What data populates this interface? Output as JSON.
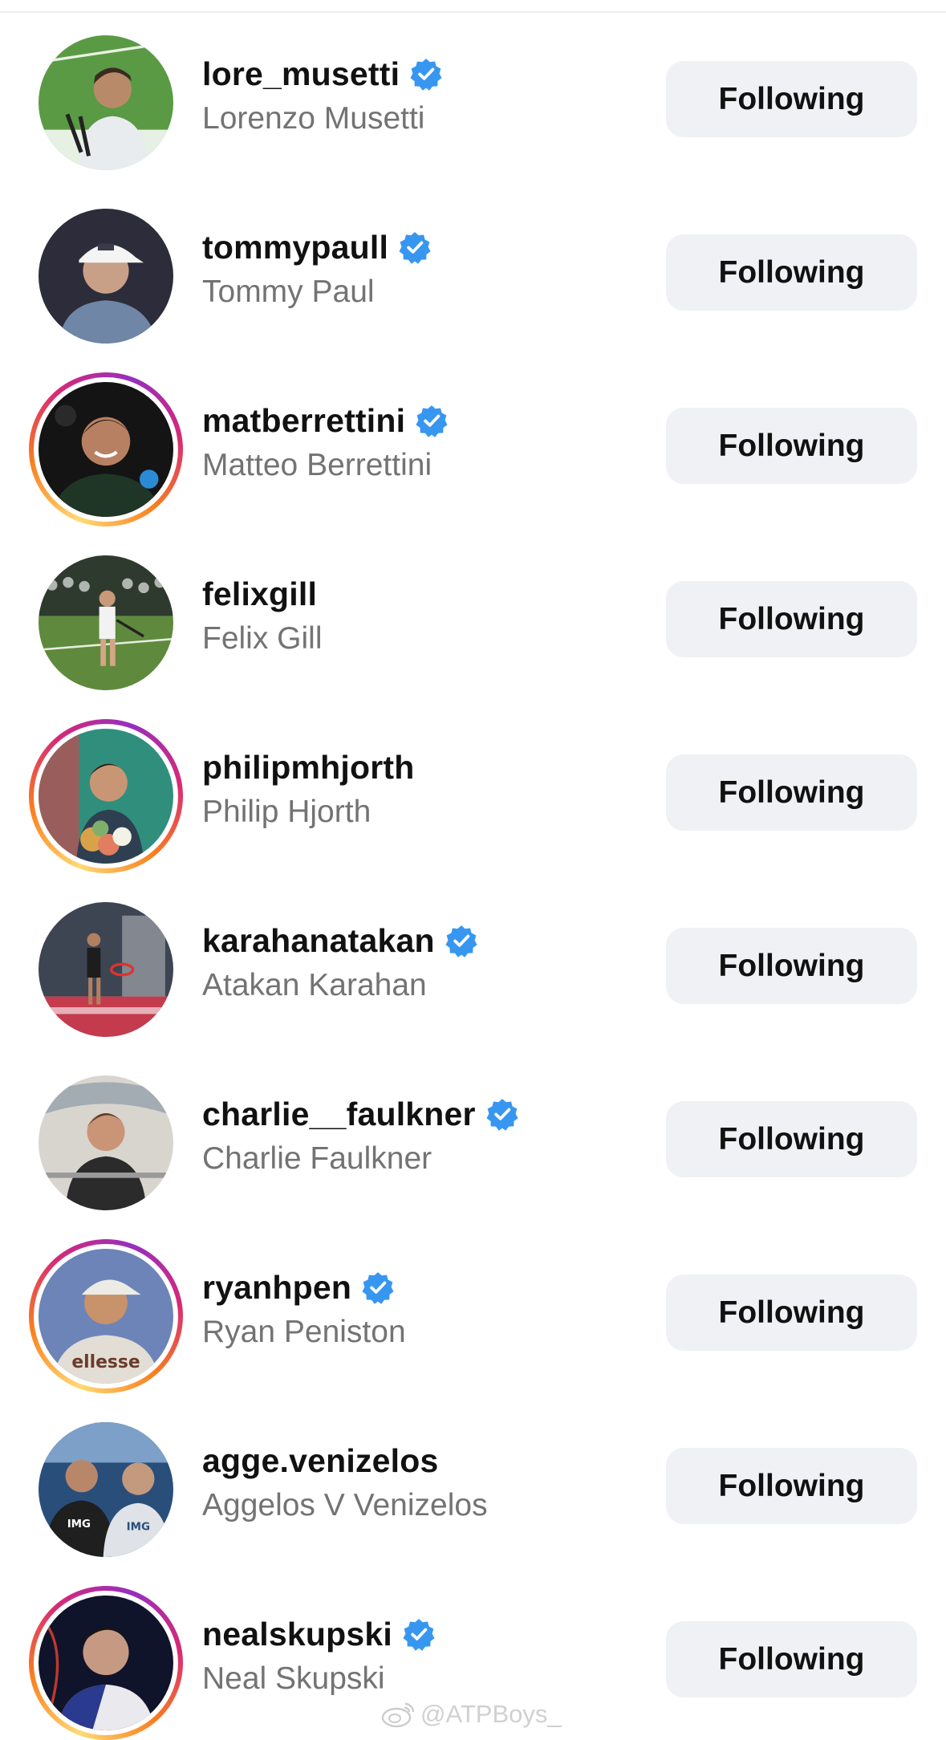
{
  "following_list": [
    {
      "username": "lore_musetti",
      "full_name": "Lorenzo Musetti",
      "verified": true,
      "story_ring": false,
      "button_label": "Following",
      "avatar_icon": "avatar-press-conference",
      "avatar_colors": [
        "#5a9a45",
        "#e9ecef",
        "#b98a6a"
      ]
    },
    {
      "username": "tommypaull",
      "full_name": "Tommy Paul",
      "verified": true,
      "story_ring": false,
      "button_label": "Following",
      "avatar_icon": "avatar-cap-portrait",
      "avatar_colors": [
        "#2c2c3a",
        "#6f86a6",
        "#c8a088"
      ]
    },
    {
      "username": "matberrettini",
      "full_name": "Matteo Berrettini",
      "verified": true,
      "story_ring": true,
      "button_label": "Following",
      "avatar_icon": "avatar-smiling-portrait",
      "avatar_colors": [
        "#141414",
        "#1f3526",
        "#b88062"
      ]
    },
    {
      "username": "felixgill",
      "full_name": "Felix Gill",
      "verified": false,
      "story_ring": false,
      "button_label": "Following",
      "avatar_icon": "avatar-grass-court",
      "avatar_colors": [
        "#5f8a3d",
        "#2e3a2e",
        "#f2f2f2"
      ]
    },
    {
      "username": "philipmhjorth",
      "full_name": "Philip Hjorth",
      "verified": false,
      "story_ring": true,
      "button_label": "Following",
      "avatar_icon": "avatar-flowers",
      "avatar_colors": [
        "#2f8f7c",
        "#2f3f52",
        "#d9a24a"
      ]
    },
    {
      "username": "karahanatakan",
      "full_name": "Atakan Karahan",
      "verified": true,
      "story_ring": false,
      "button_label": "Following",
      "avatar_icon": "avatar-indoor-court",
      "avatar_colors": [
        "#3d4452",
        "#b0b4ba",
        "#c43b4e"
      ]
    },
    {
      "username": "charlie__faulkner",
      "full_name": "Charlie Faulkner",
      "verified": true,
      "story_ring": false,
      "button_label": "Following",
      "avatar_icon": "avatar-boat",
      "avatar_colors": [
        "#8d9aa6",
        "#d8d5cf",
        "#2b2b2b"
      ]
    },
    {
      "username": "ryanhpen",
      "full_name": "Ryan Peniston",
      "verified": true,
      "story_ring": true,
      "button_label": "Following",
      "avatar_icon": "avatar-ellesse-tee",
      "avatar_colors": [
        "#6d84b8",
        "#e2ded5",
        "#c8926a"
      ]
    },
    {
      "username": "agge.venizelos",
      "full_name": "Aggelos V Venizelos",
      "verified": false,
      "story_ring": false,
      "button_label": "Following",
      "avatar_icon": "avatar-two-people",
      "avatar_colors": [
        "#2a4e7a",
        "#1f1f1f",
        "#dfe3e8"
      ]
    },
    {
      "username": "nealskupski",
      "full_name": "Neal Skupski",
      "verified": true,
      "story_ring": true,
      "button_label": "Following",
      "avatar_icon": "avatar-dark-portrait",
      "avatar_colors": [
        "#10142a",
        "#2a3a8f",
        "#e9e9ee"
      ]
    }
  ],
  "verified_icon": "verified-badge-icon",
  "verified_color": "#3797f0",
  "button_bg": "#eff1f4",
  "watermark": {
    "text": "@ATPBoys_",
    "icon": "weibo-icon"
  }
}
